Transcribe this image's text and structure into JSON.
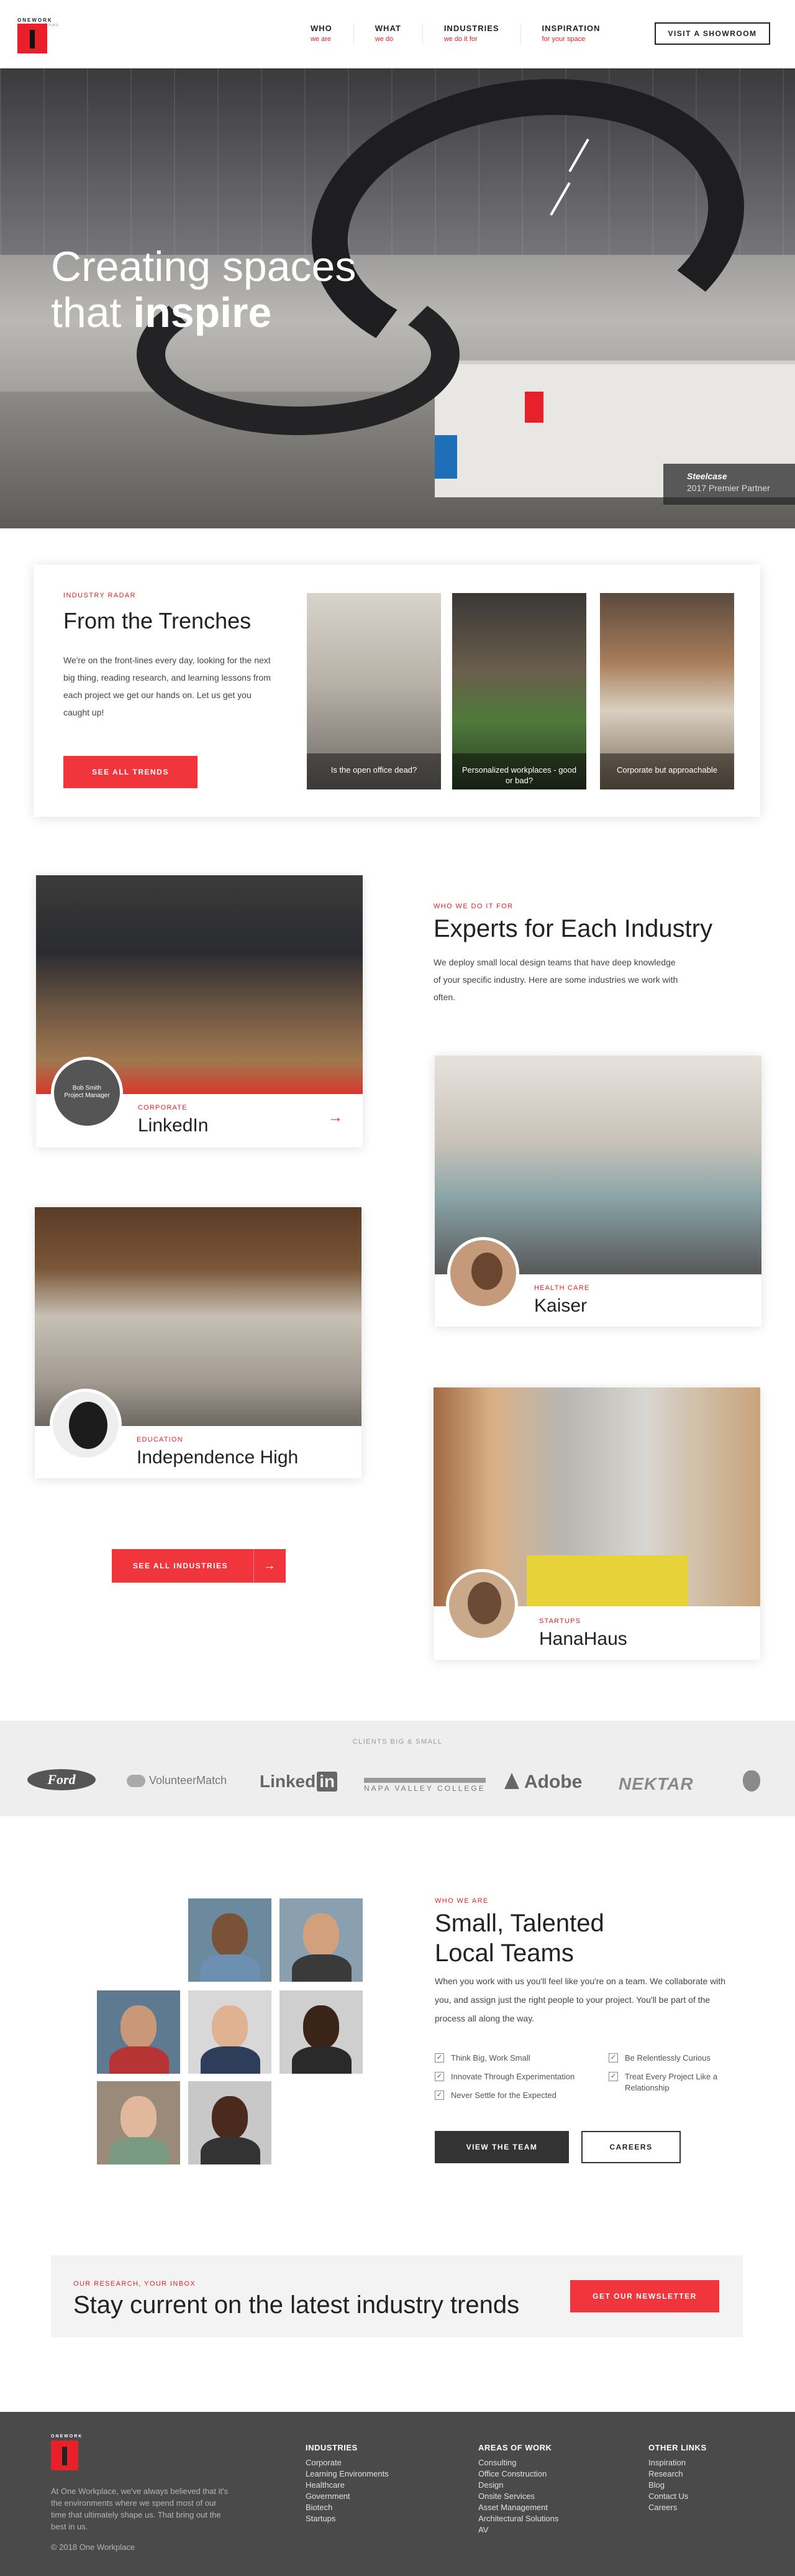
{
  "header": {
    "logo_word": "ONEWORK",
    "logo_side": "PLACE",
    "nav": [
      {
        "title": "WHO",
        "sub": "we are"
      },
      {
        "title": "WHAT",
        "sub": "we do"
      },
      {
        "title": "INDUSTRIES",
        "sub": "we do it for"
      },
      {
        "title": "INSPIRATION",
        "sub": "for your space"
      }
    ],
    "cta": "VISIT A SHOWROOM"
  },
  "hero": {
    "title_line1": "Creating spaces",
    "title_line2_plain": "that ",
    "title_line2_bold": "inspire",
    "partner_brand": "Steelcase",
    "partner_line": "2017 Premier Partner"
  },
  "trends": {
    "eyebrow": "INDUSTRY RADAR",
    "title": "From the Trenches",
    "body": "We're on the front-lines every day, looking for the next big thing, reading research, and learning lessons from each project we get our hands on. Let us get you caught up!",
    "button": "SEE ALL TRENDS",
    "cards": [
      {
        "caption": "Is the open office dead?"
      },
      {
        "caption": "Personalized workplaces - good or bad?"
      },
      {
        "caption": "Corporate but approachable"
      }
    ]
  },
  "industries": {
    "eyebrow": "WHO WE DO IT FOR",
    "title": "Experts for Each Industry",
    "body": "We deploy small local design teams that have deep knowledge of your specific industry. Here are some industries we work with often.",
    "avatar_overlay_name": "Bob Smith",
    "avatar_overlay_role": "Project Manager",
    "cards": [
      {
        "tag": "CORPORATE",
        "name": "LinkedIn"
      },
      {
        "tag": "HEALTH CARE",
        "name": "Kaiser"
      },
      {
        "tag": "EDUCATION",
        "name": "Independence High"
      },
      {
        "tag": "STARTUPS",
        "name": "HanaHaus"
      }
    ],
    "button": "SEE ALL INDUSTRIES",
    "arrow": "→"
  },
  "clients": {
    "eyebrow": "CLIENTS BIG & SMALL",
    "logos": [
      "Ford",
      "VolunteerMatch",
      "Linked",
      "in",
      "NAPA VALLEY COLLEGE",
      "Adobe",
      "NEKTAR"
    ]
  },
  "team": {
    "eyebrow": "WHO WE ARE",
    "title_line1": "Small, Talented",
    "title_line2": "Local Teams",
    "body": "When you work with us you'll feel like you're on a team. We collaborate with you, and assign just the right people to your project. You'll be part of the process all along the way.",
    "checks": [
      "Think Big, Work Small",
      "Innovate Through Experimentation",
      "Never Settle for the Expected",
      "Be Relentlessly Curious",
      "Treat Every Project Like a Relationship"
    ],
    "btn_primary": "VIEW THE TEAM",
    "btn_secondary": "CAREERS"
  },
  "newsletter": {
    "eyebrow": "OUR RESEARCH, YOUR INBOX",
    "title": "Stay current on the latest industry trends",
    "button": "GET OUR NEWSLETTER"
  },
  "footer": {
    "logo_word": "ONEWORK",
    "about": "At One Workplace, we've always believed that it's the environments where we spend most of our time that ultimately shape us. That bring out the best in us.",
    "copyright": "© 2018 One Workplace",
    "columns": [
      {
        "heading": "INDUSTRIES",
        "items": [
          "Corporate",
          "Learning Environments",
          "Healthcare",
          "Government",
          "Biotech",
          "Startups"
        ]
      },
      {
        "heading": "AREAS OF WORK",
        "items": [
          "Consulting",
          "Office Construction",
          "Design",
          "Onsite Services",
          "Asset Management",
          "Architectural Solutions",
          "AV"
        ]
      },
      {
        "heading": "OTHER LINKS",
        "items": [
          "Inspiration",
          "Research",
          "Blog",
          "Contact Us",
          "Careers"
        ]
      }
    ]
  },
  "colors": {
    "accent": "#e8202a",
    "button_red": "#f0363c",
    "footer_bg": "#4a4a4a",
    "dark_button": "#333333"
  }
}
